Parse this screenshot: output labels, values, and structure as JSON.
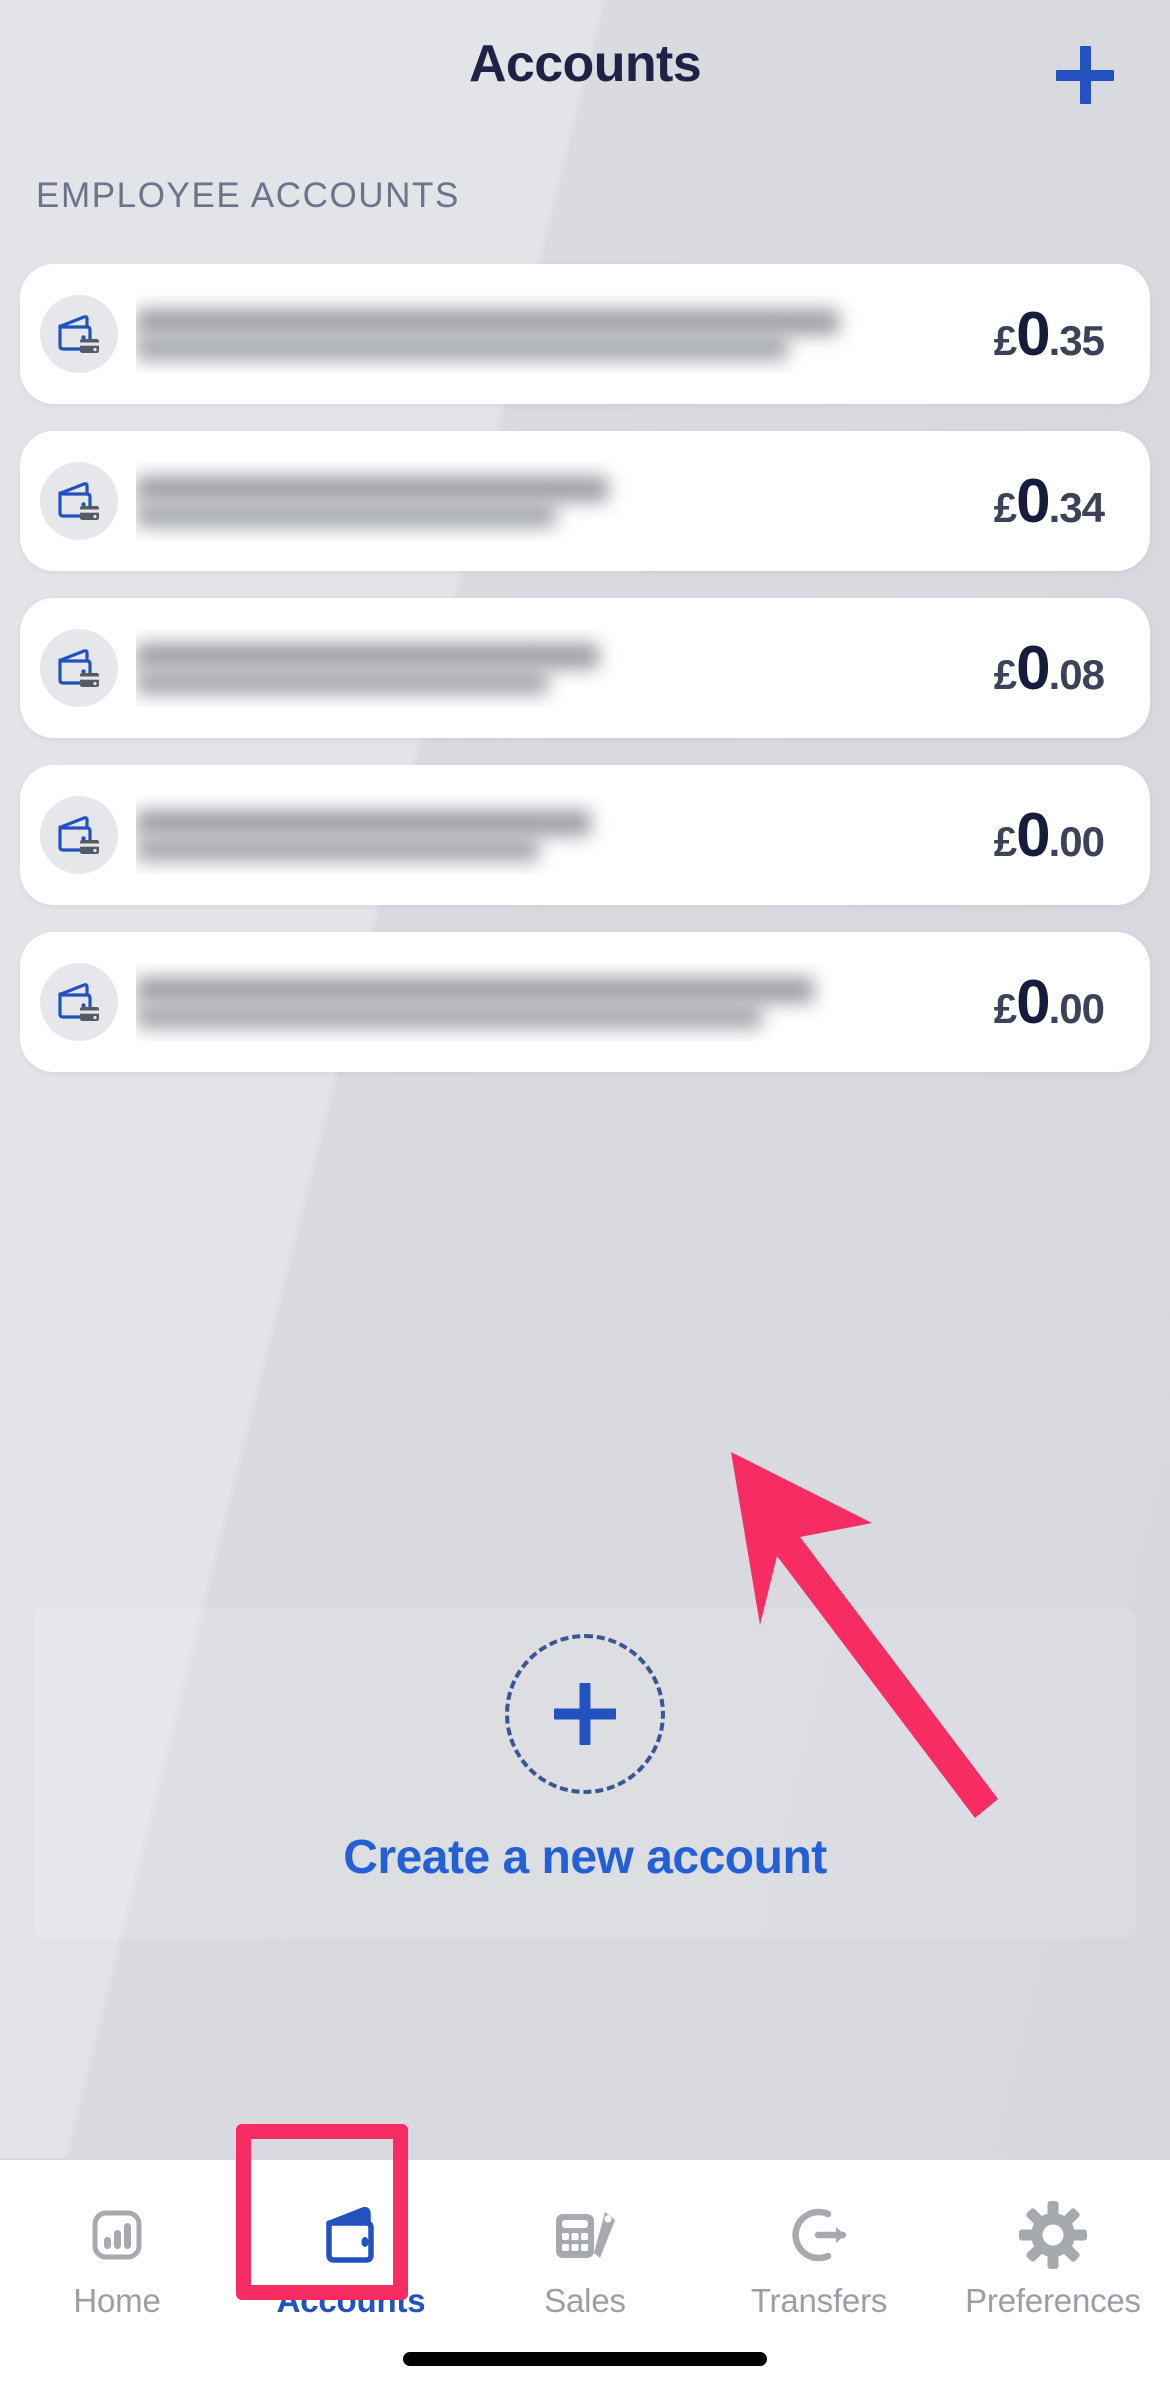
{
  "header": {
    "title": "Accounts",
    "add_button_icon": "plus-icon"
  },
  "section": {
    "label": "EMPLOYEE ACCOUNTS"
  },
  "accounts": [
    {
      "name_redacted": true,
      "icon": "wallet-card-icon",
      "currency": "£",
      "whole": "0",
      "decimals": ".35",
      "name_width_pct": 82
    },
    {
      "name_redacted": true,
      "icon": "wallet-card-icon",
      "currency": "£",
      "whole": "0",
      "decimals": ".34",
      "name_width_pct": 55
    },
    {
      "name_redacted": true,
      "icon": "wallet-card-icon",
      "currency": "£",
      "whole": "0",
      "decimals": ".08",
      "name_width_pct": 54
    },
    {
      "name_redacted": true,
      "icon": "wallet-card-icon",
      "currency": "£",
      "whole": "0",
      "decimals": ".00",
      "name_width_pct": 53
    },
    {
      "name_redacted": true,
      "icon": "wallet-card-icon",
      "currency": "£",
      "whole": "0",
      "decimals": ".00",
      "name_width_pct": 79
    }
  ],
  "create_account": {
    "label": "Create a new account",
    "icon": "plus-icon"
  },
  "annotation": {
    "arrow_color": "#f62c62",
    "highlight_color": "#f62c62"
  },
  "tab_bar": {
    "active": "Accounts",
    "tabs": [
      {
        "label": "Home",
        "icon": "bar-chart-icon"
      },
      {
        "label": "Accounts",
        "icon": "wallet-icon"
      },
      {
        "label": "Sales",
        "icon": "calculator-pen-icon"
      },
      {
        "label": "Transfers",
        "icon": "arc-arrow-icon"
      },
      {
        "label": "Preferences",
        "icon": "gear-icon"
      }
    ]
  },
  "colors": {
    "accent_blue": "#2351c0",
    "title_navy": "#1f2244",
    "muted_grey": "#9b9ea4",
    "annotation_pink": "#f62c62",
    "background": "#e0e2e6"
  }
}
